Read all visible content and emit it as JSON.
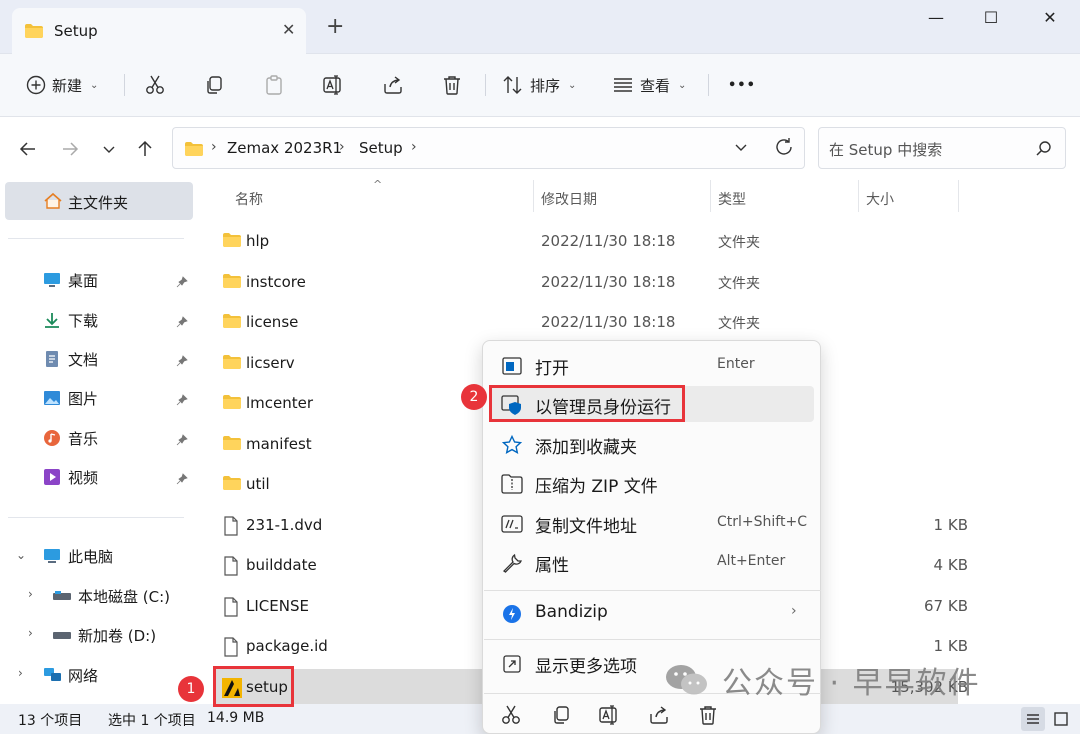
{
  "window": {
    "tab_title": "Setup",
    "tab_close": "✕",
    "new_tab": "+",
    "minimize": "—",
    "maximize": "☐",
    "close": "✕"
  },
  "toolbar": {
    "new_label": "新建",
    "sort_label": "排序",
    "view_label": "查看",
    "more_label": "•••"
  },
  "address": {
    "crumbs": [
      "Zemax 2023R1",
      "Setup"
    ],
    "search_placeholder": "在 Setup 中搜索"
  },
  "sidebar": {
    "home": "主文件夹",
    "quick": [
      {
        "label": "桌面",
        "icon": "desktop-icon"
      },
      {
        "label": "下载",
        "icon": "download-icon"
      },
      {
        "label": "文档",
        "icon": "document-icon"
      },
      {
        "label": "图片",
        "icon": "picture-icon"
      },
      {
        "label": "音乐",
        "icon": "music-icon"
      },
      {
        "label": "视频",
        "icon": "video-icon"
      }
    ],
    "this_pc": "此电脑",
    "drives": [
      "本地磁盘 (C:)",
      "新加卷 (D:)"
    ],
    "network": "网络"
  },
  "columns": {
    "name": "名称",
    "date": "修改日期",
    "type": "类型",
    "size": "大小"
  },
  "files": [
    {
      "name": "hlp",
      "date": "2022/11/30 18:18",
      "type": "文件夹",
      "size": "",
      "kind": "folder"
    },
    {
      "name": "instcore",
      "date": "2022/11/30 18:18",
      "type": "文件夹",
      "size": "",
      "kind": "folder"
    },
    {
      "name": "license",
      "date": "2022/11/30 18:18",
      "type": "文件夹",
      "size": "",
      "kind": "folder"
    },
    {
      "name": "licserv",
      "date": "",
      "type": "",
      "size": "",
      "kind": "folder"
    },
    {
      "name": "lmcenter",
      "date": "",
      "type": "",
      "size": "",
      "kind": "folder"
    },
    {
      "name": "manifest",
      "date": "",
      "type": "",
      "size": "",
      "kind": "folder"
    },
    {
      "name": "util",
      "date": "",
      "type": "",
      "size": "",
      "kind": "folder"
    },
    {
      "name": "231-1.dvd",
      "date": "",
      "type": "",
      "size": "1 KB",
      "kind": "file"
    },
    {
      "name": "builddate",
      "date": "",
      "type": "",
      "size": "4 KB",
      "kind": "file"
    },
    {
      "name": "LICENSE",
      "date": "",
      "type": "",
      "size": "67 KB",
      "kind": "file"
    },
    {
      "name": "package.id",
      "date": "",
      "type": "",
      "size": "1 KB",
      "kind": "file"
    },
    {
      "name": "setup",
      "date": "",
      "type": "",
      "size": "15,302 KB",
      "kind": "app"
    }
  ],
  "context_menu": {
    "items": [
      {
        "label": "打开",
        "shortcut": "Enter"
      },
      {
        "label": "以管理员身份运行",
        "shortcut": ""
      },
      {
        "label": "添加到收藏夹",
        "shortcut": ""
      },
      {
        "label": "压缩为 ZIP 文件",
        "shortcut": ""
      },
      {
        "label": "复制文件地址",
        "shortcut": "Ctrl+Shift+C"
      },
      {
        "label": "属性",
        "shortcut": "Alt+Enter"
      },
      {
        "label": "Bandizip",
        "shortcut": ""
      },
      {
        "label": "显示更多选项",
        "shortcut": ""
      }
    ]
  },
  "status": {
    "count": "13 个项目",
    "selected": "选中 1 个项目",
    "size": "14.9 MB"
  },
  "annotations": {
    "step1": "1",
    "step2": "2"
  },
  "watermark": {
    "text": "公众号 · 早早软件"
  },
  "colors": {
    "folder": "#f3c13a",
    "accent": "#0067c0",
    "annotation_red": "#e8343a"
  }
}
